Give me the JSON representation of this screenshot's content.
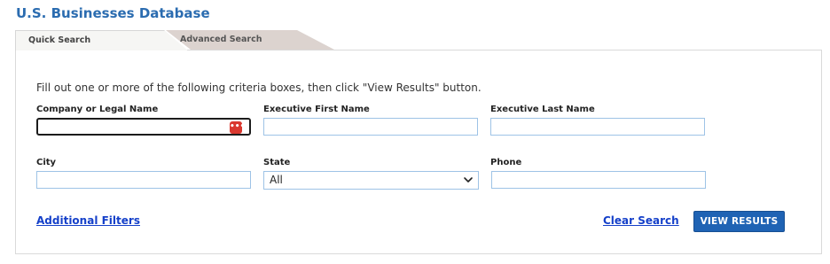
{
  "page": {
    "title": "U.S. Businesses Database"
  },
  "tabs": [
    {
      "label": "Quick Search",
      "active": true
    },
    {
      "label": "Advanced Search",
      "active": false
    }
  ],
  "form": {
    "instructions": "Fill out one or more of the following criteria boxes, then click \"View Results\" button.",
    "fields": {
      "company": {
        "label": "Company or Legal Name",
        "value": "",
        "placeholder": ""
      },
      "exec_first": {
        "label": "Executive First Name",
        "value": "",
        "placeholder": ""
      },
      "exec_last": {
        "label": "Executive Last Name",
        "value": "",
        "placeholder": ""
      },
      "city": {
        "label": "City",
        "value": "",
        "placeholder": ""
      },
      "state": {
        "label": "State",
        "selected": "All"
      },
      "phone": {
        "label": "Phone",
        "value": "",
        "placeholder": ""
      }
    },
    "company_input_icon": "dots-icon"
  },
  "actions": {
    "additional_filters": "Additional Filters",
    "clear_search": "Clear Search",
    "view_results": "VIEW RESULTS"
  },
  "colors": {
    "title": "#2b6cb0",
    "link": "#1540c9",
    "primary_button": "#1f63b4",
    "input_border": "#9ec3e6",
    "icon_badge": "#d9382f"
  }
}
